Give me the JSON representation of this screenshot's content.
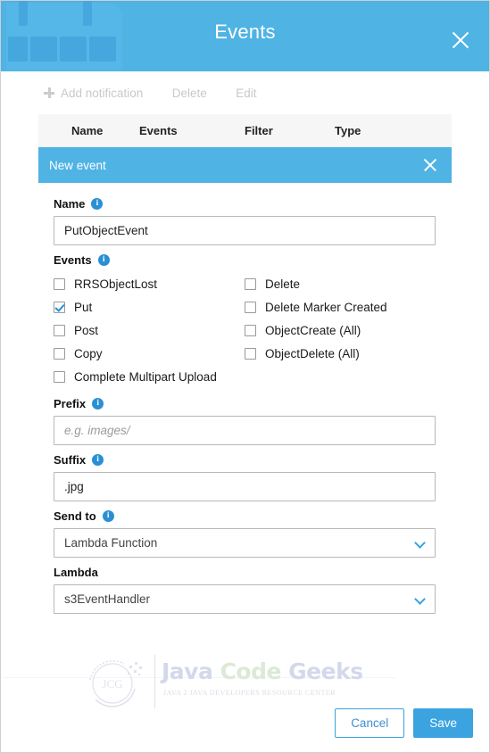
{
  "window": {
    "title": "Events",
    "close_icon": "close-icon"
  },
  "toolbar": {
    "add_label": "Add notification",
    "delete_label": "Delete",
    "edit_label": "Edit",
    "add_icon": "plus-icon"
  },
  "table": {
    "columns": [
      "Name",
      "Events",
      "Filter",
      "Type"
    ]
  },
  "new_event_row": {
    "label": "New event",
    "close_icon": "close-icon"
  },
  "form": {
    "name": {
      "label": "Name",
      "info_icon": "info-icon",
      "value": "PutObjectEvent",
      "placeholder": ""
    },
    "events": {
      "label": "Events",
      "info_icon": "info-icon",
      "left_column": [
        {
          "label": "RRSObjectLost",
          "checked": false
        },
        {
          "label": "Put",
          "checked": true
        },
        {
          "label": "Post",
          "checked": false
        },
        {
          "label": "Copy",
          "checked": false
        },
        {
          "label": "Complete Multipart Upload",
          "checked": false
        }
      ],
      "right_column": [
        {
          "label": "Delete",
          "checked": false
        },
        {
          "label": "Delete Marker Created",
          "checked": false
        },
        {
          "label": "ObjectCreate (All)",
          "checked": false
        },
        {
          "label": "ObjectDelete (All)",
          "checked": false
        }
      ]
    },
    "prefix": {
      "label": "Prefix",
      "info_icon": "info-icon",
      "value": "",
      "placeholder": "e.g. images/"
    },
    "suffix": {
      "label": "Suffix",
      "info_icon": "info-icon",
      "value": ".jpg",
      "placeholder": ""
    },
    "send_to": {
      "label": "Send to",
      "info_icon": "info-icon",
      "value": "Lambda Function",
      "chevron_icon": "chevron-down-icon"
    },
    "lambda": {
      "label": "Lambda",
      "value": "s3EventHandler",
      "chevron_icon": "chevron-down-icon"
    }
  },
  "footer": {
    "cancel_label": "Cancel",
    "save_label": "Save"
  },
  "watermark": {
    "logo_text": "JCG",
    "word1": "Java",
    "word2": "Code",
    "word3": "Geeks",
    "subtitle": "JAVA 2 JAVA DEVELOPERS RESOURCE CENTER"
  },
  "colors": {
    "accent": "#4fb3e4",
    "accent_dark": "#3aa3e0",
    "info": "#2a8fd4",
    "disabled_text": "#c9c9c9"
  }
}
